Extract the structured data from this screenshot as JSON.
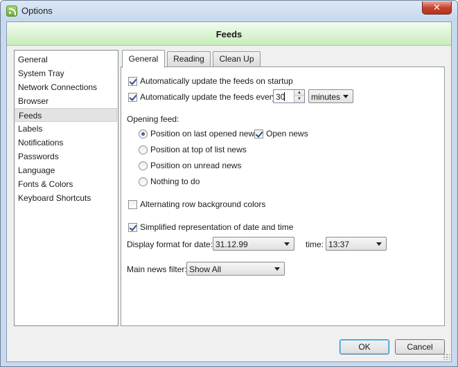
{
  "window": {
    "title": "Options",
    "close_glyph": "✕",
    "icon": "rss-icon"
  },
  "header": {
    "title": "Feeds"
  },
  "sidebar": {
    "items": [
      {
        "label": "General"
      },
      {
        "label": "System Tray"
      },
      {
        "label": "Network Connections"
      },
      {
        "label": "Browser"
      },
      {
        "label": "Feeds",
        "selected": true
      },
      {
        "label": "Labels"
      },
      {
        "label": "Notifications"
      },
      {
        "label": "Passwords"
      },
      {
        "label": "Language"
      },
      {
        "label": "Fonts & Colors"
      },
      {
        "label": "Keyboard Shortcuts"
      }
    ]
  },
  "tabs": [
    {
      "label": "General",
      "active": true
    },
    {
      "label": "Reading",
      "active": false
    },
    {
      "label": "Clean Up",
      "active": false
    }
  ],
  "general": {
    "update_on_startup": {
      "label": "Automatically update the feeds on startup",
      "checked": true
    },
    "update_every": {
      "label": "Automatically update the feeds every",
      "checked": true,
      "value": "30",
      "unit": "minutes"
    },
    "opening_feed": {
      "label": "Opening feed:",
      "options": [
        {
          "label": "Position on last opened news",
          "checked": true
        },
        {
          "label": "Position at top of list news",
          "checked": false
        },
        {
          "label": "Position on unread news",
          "checked": false
        },
        {
          "label": "Nothing to do",
          "checked": false
        }
      ],
      "open_news": {
        "label": "Open news",
        "checked": true
      }
    },
    "alternating_rows": {
      "label": "Alternating row background colors",
      "checked": false
    },
    "simplified_date": {
      "label": "Simplified representation of date and time",
      "checked": true
    },
    "date_format": {
      "label": "Display format for date:",
      "value": "31.12.99"
    },
    "time_format": {
      "label": "time:",
      "value": "13:37"
    },
    "news_filter": {
      "label": "Main news filter:",
      "value": "Show All"
    }
  },
  "buttons": {
    "ok": "OK",
    "cancel": "Cancel"
  },
  "colors": {
    "header_green": "#c8edbb",
    "frame_blue": "#c9d9ee",
    "close_red": "#c7432c"
  }
}
